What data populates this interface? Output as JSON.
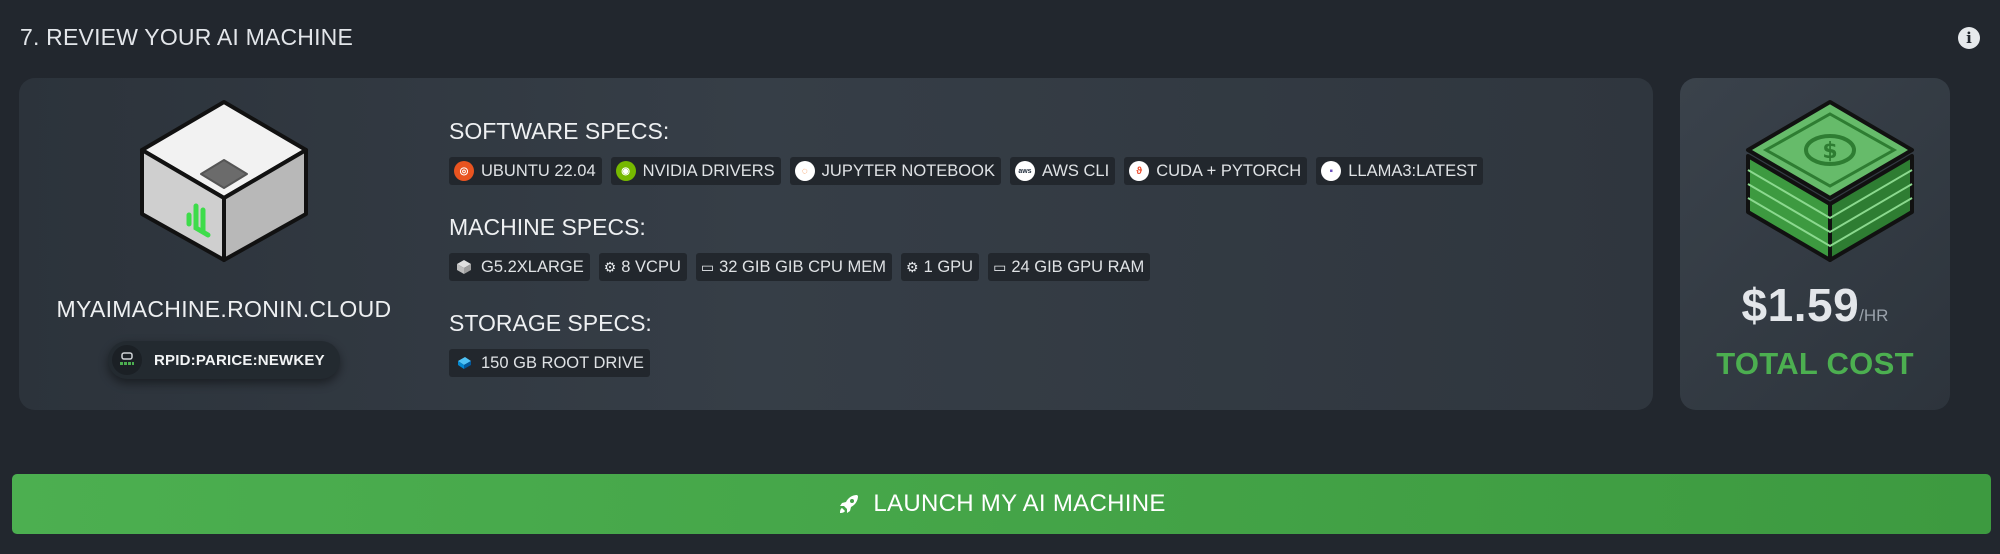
{
  "section": {
    "title": "7. REVIEW YOUR AI MACHINE",
    "info_icon": "info-circle-icon"
  },
  "machine": {
    "hostname": "MYAIMACHINE.RONIN.CLOUD",
    "key": "RPID:PARICE:NEWKEY"
  },
  "software": {
    "title": "SOFTWARE SPECS:",
    "items": [
      {
        "label": "UBUNTU 22.04",
        "icon": "ubuntu-icon",
        "color": "#e95420"
      },
      {
        "label": "NVIDIA DRIVERS",
        "icon": "nvidia-icon",
        "color": "#76b900"
      },
      {
        "label": "JUPYTER NOTEBOOK",
        "icon": "jupyter-icon",
        "color": "#f37726"
      },
      {
        "label": "AWS CLI",
        "icon": "aws-icon",
        "color": "#ffffff"
      },
      {
        "label": "CUDA + PYTORCH",
        "icon": "pytorch-icon",
        "color": "#ffffff"
      },
      {
        "label": "LLAMA3:LATEST",
        "icon": "ollama-icon",
        "color": "#ffffff"
      }
    ]
  },
  "machine_specs": {
    "title": "MACHINE SPECS:",
    "items": [
      {
        "label": "G5.2XLARGE",
        "icon": "instance-box-icon"
      },
      {
        "label": "8 VCPU",
        "icon": "cpu-icon"
      },
      {
        "label": "32 GIB GIB CPU MEM",
        "icon": "memory-icon"
      },
      {
        "label": "1 GPU",
        "icon": "gpu-icon"
      },
      {
        "label": "24 GIB GPU RAM",
        "icon": "memory-icon"
      }
    ]
  },
  "storage": {
    "title": "STORAGE SPECS:",
    "items": [
      {
        "label": "150 GB ROOT DRIVE",
        "icon": "drive-icon"
      }
    ]
  },
  "cost": {
    "amount": "$1.59",
    "unit": "/HR",
    "label": "TOTAL COST"
  },
  "launch": {
    "label": "LAUNCH MY AI MACHINE",
    "icon": "rocket-icon"
  },
  "colors": {
    "accent": "#4caf50",
    "background": "#22272e",
    "card": "#2c333b"
  }
}
